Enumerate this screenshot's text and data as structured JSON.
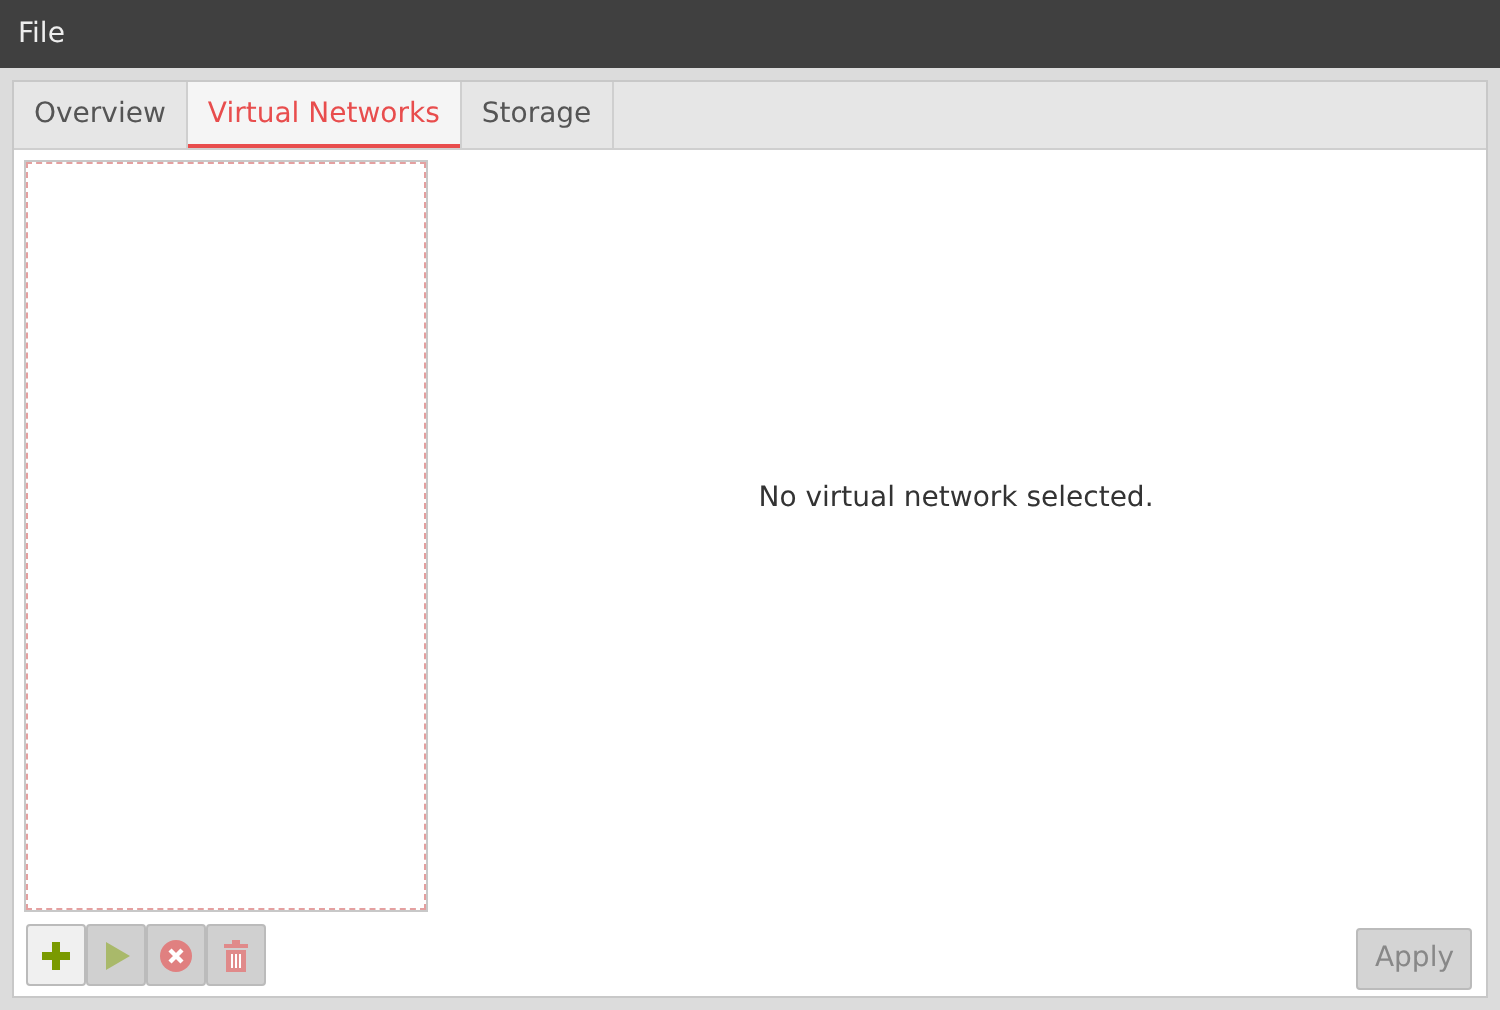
{
  "menu": [
    {
      "label": "File"
    }
  ],
  "tabs": [
    {
      "label": "Overview",
      "selected": false
    },
    {
      "label": "Virtual Networks",
      "selected": true
    },
    {
      "label": "Storage",
      "selected": false
    }
  ],
  "message": "No virtual network selected.",
  "toolbar": [
    {
      "kind": "add",
      "disabled": false
    },
    {
      "kind": "start",
      "disabled": true
    },
    {
      "kind": "stop",
      "disabled": true
    },
    {
      "kind": "delete",
      "disabled": true
    }
  ],
  "apply": {
    "label": "Apply",
    "disabled": true
  }
}
